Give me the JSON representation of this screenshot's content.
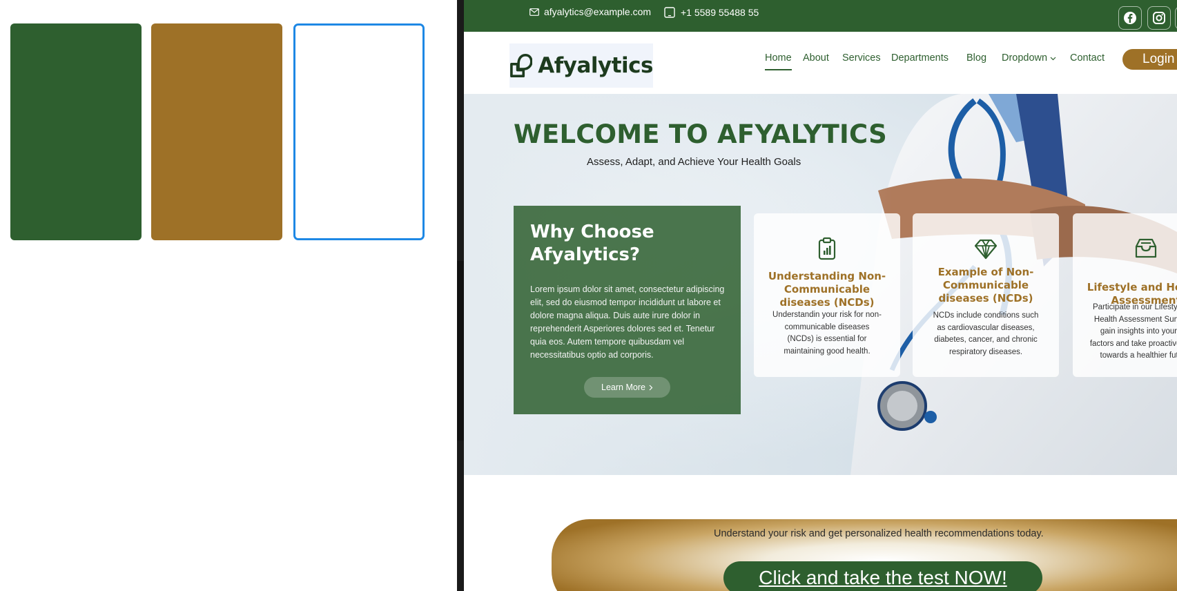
{
  "palette": {
    "swatches": [
      {
        "name": "primary-green",
        "color": "#2e5f2f"
      },
      {
        "name": "accent-gold",
        "color": "#9e7127"
      },
      {
        "name": "white",
        "color": "#ffffff",
        "selected": true
      }
    ]
  },
  "topbar": {
    "email": "afyalytics@example.com",
    "phone": "+1 5589 55488 55",
    "social": [
      "facebook-icon",
      "instagram-icon"
    ]
  },
  "header": {
    "logo_text": "Afyalytics",
    "nav": [
      "Home",
      "About",
      "Services",
      "Departments",
      "Blog",
      "Dropdown",
      "Contact"
    ],
    "active_nav": "Home",
    "login_label": "Login"
  },
  "hero": {
    "title": "WELCOME TO AFYALYTICS",
    "subtitle": "Assess, Adapt, and Achieve Your Health Goals",
    "why": {
      "title": "Why Choose Afyalytics?",
      "text": "Lorem ipsum dolor sit amet, consectetur adipiscing elit, sed do eiusmod tempor incididunt ut labore et dolore magna aliqua. Duis aute irure dolor in reprehenderit Asperiores dolores sed et. Tenetur quia eos. Autem tempore quibusdam vel necessitatibus optio ad corporis.",
      "button": "Learn More"
    },
    "cards": [
      {
        "icon": "clipboard-chart-icon",
        "title": "Understanding Non-Communicable diseases (NCDs)",
        "text": "Understandin your risk for non-communicable diseases (NCDs) is essential for maintaining good health."
      },
      {
        "icon": "gem-icon",
        "title": "Example of Non-Communicable diseases (NCDs)",
        "text": "NCDs include conditions such as cardiovascular diseases, diabetes, cancer, and chronic respiratory diseases."
      },
      {
        "icon": "inbox-icon",
        "title": "Lifestyle and Health Assessment",
        "text": "Participate in our Lifestyle and Health Assessment Survey to gain insights into your risk factors and take proactive steps towards a healthier future."
      }
    ]
  },
  "cta": {
    "text": "Understand your risk and get personalized health recommendations today.",
    "button": "Click and take the test NOW!"
  },
  "colors": {
    "green": "#2e5f2f",
    "gold": "#9e7127",
    "selection_blue": "#1e88e5"
  }
}
